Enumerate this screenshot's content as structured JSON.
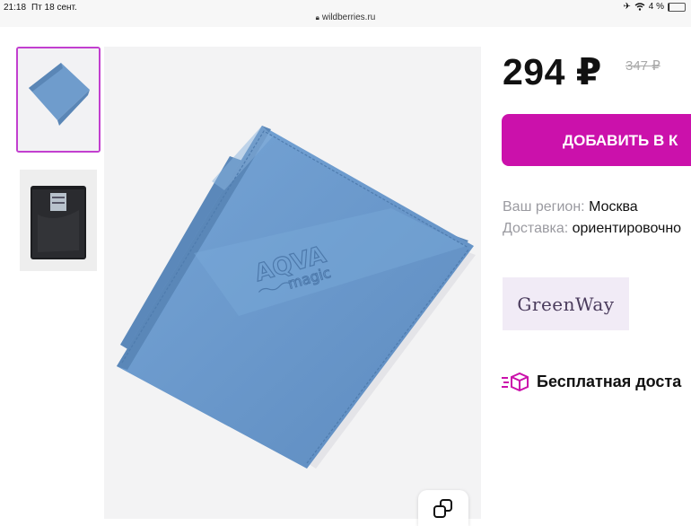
{
  "status_bar": {
    "time": "21:18",
    "date": "Пт 18 сент.",
    "battery": "4 %",
    "url": "wildberries.ru"
  },
  "gallery": {
    "thumbnails": [
      {
        "label": "blue cloth",
        "selected": true
      },
      {
        "label": "black package",
        "selected": false
      }
    ]
  },
  "product": {
    "price": "294 ₽",
    "old_price": "347 ₽",
    "add_button": "ДОБАВИТЬ В К",
    "region_label": "Ваш регион:",
    "region_value": "Москва",
    "delivery_label": "Доставка:",
    "delivery_value": "ориентировочно",
    "brand": "GreenWay",
    "free_delivery": "Бесплатная доста",
    "accent_color": "#cb11ab"
  },
  "main_image": {
    "logo_text_top": "AQVA",
    "logo_text_bottom": "magic"
  }
}
